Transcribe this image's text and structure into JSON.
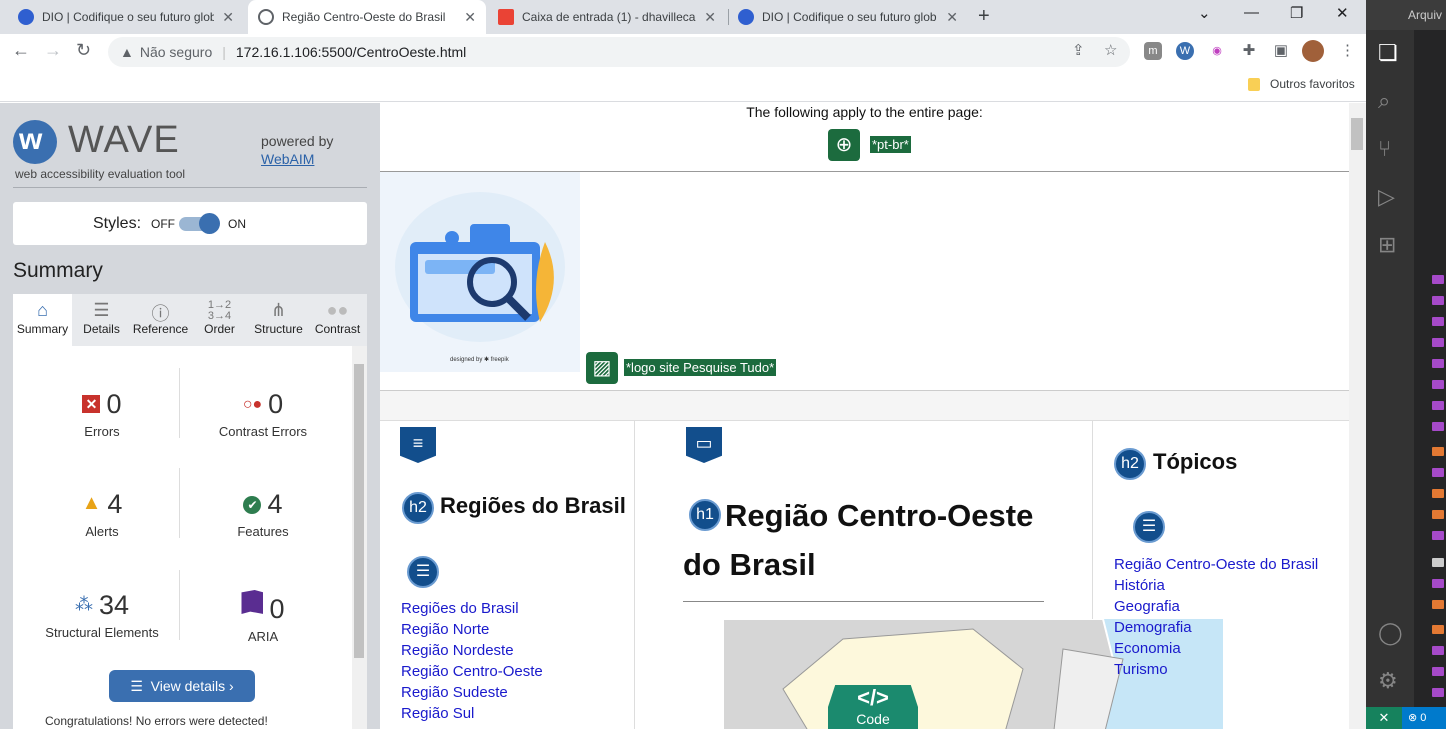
{
  "browser": {
    "tabs": [
      {
        "title": "DIO | Codifique o seu futuro glob",
        "favicon_color": "#2f5fd0"
      },
      {
        "title": "Região Centro-Oeste do Brasil",
        "favicon_color": "#5f6368"
      },
      {
        "title": "Caixa de entrada (1) - dhavillecar",
        "favicon_color": "#ea4335"
      },
      {
        "title": "DIO | Codifique o seu futuro glob",
        "favicon_color": "#2f5fd0"
      }
    ],
    "address": {
      "security": "Não seguro",
      "url": "172.16.1.106:5500/CentroOeste.html"
    },
    "bookmark_folder": "Outros favoritos"
  },
  "wave": {
    "title": "WAVE",
    "subtitle": "web accessibility evaluation tool",
    "powered_by": "powered by",
    "webaim": "WebAIM",
    "styles_label": "Styles:",
    "off": "OFF",
    "on": "ON",
    "summary_heading": "Summary",
    "tabs": [
      "Summary",
      "Details",
      "Reference",
      "Order",
      "Structure",
      "Contrast"
    ],
    "stats": {
      "errors": {
        "value": "0",
        "label": "Errors"
      },
      "contrast": {
        "value": "0",
        "label": "Contrast Errors"
      },
      "alerts": {
        "value": "4",
        "label": "Alerts"
      },
      "features": {
        "value": "4",
        "label": "Features"
      },
      "structural": {
        "value": "34",
        "label": "Structural Elements"
      },
      "aria": {
        "value": "0",
        "label": "ARIA"
      }
    },
    "view_details": "View details ›",
    "congrats": "Congratulations! No errors were detected!"
  },
  "page": {
    "applies_text": "The following apply to the entire page:",
    "lang_label": "*pt-br*",
    "logo_label": "*logo site Pesquise Tudo*",
    "h2_left": "Regiões do Brasil",
    "left_links": [
      "Regiões do Brasil",
      "Região Norte",
      "Região Nordeste",
      "Região Centro-Oeste",
      "Região Sudeste",
      "Região Sul"
    ],
    "h1": "Região Centro-Oeste do Brasil",
    "h2_right": "Tópicos",
    "right_links": [
      "Região Centro-Oeste do Brasil",
      "História",
      "Geografia",
      "Demografia",
      "Economia",
      "Turismo"
    ],
    "code_badge": "Code",
    "heading_badges": {
      "h1": "h1",
      "h2": "h2"
    }
  },
  "vscode": {
    "title": "Arquiv",
    "status_errors": "0"
  }
}
